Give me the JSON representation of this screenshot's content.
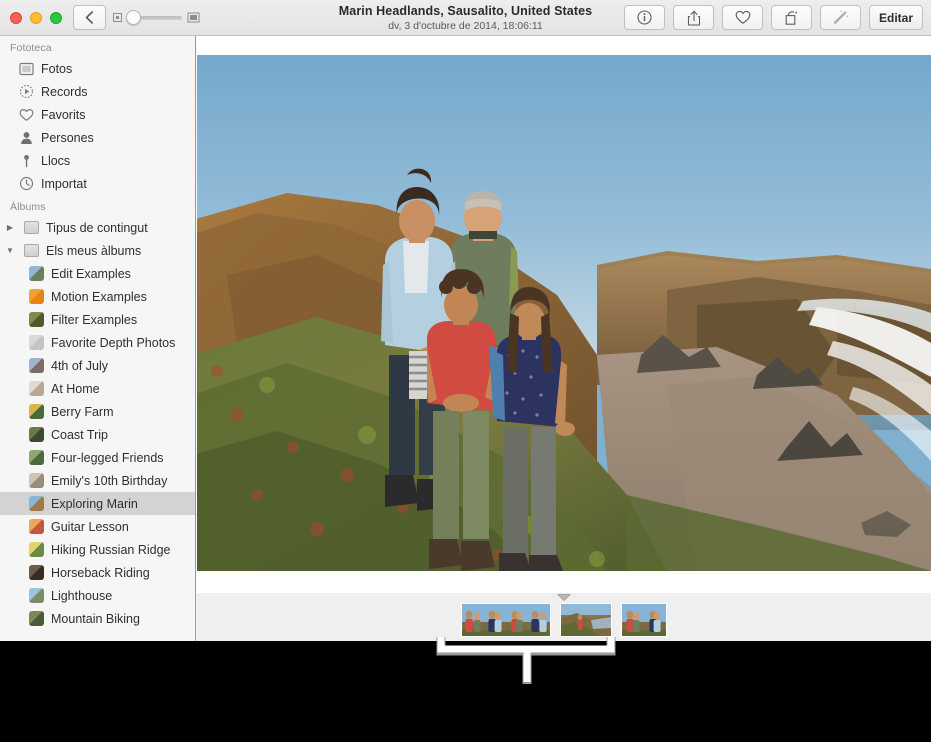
{
  "window": {
    "title": "Marin Headlands, Sausalito, United States",
    "subtitle": "dv, 3 d'octubre de 2014, 18:06:11"
  },
  "titlebar": {
    "traffic_lights": [
      {
        "name": "close",
        "color": "#ff5f57"
      },
      {
        "name": "minimize",
        "color": "#ffbd2e"
      },
      {
        "name": "zoom",
        "color": "#28c941"
      }
    ],
    "back_button": "back-icon",
    "zoom_slider": {
      "small_icon": "small-thumbnail-icon",
      "large_icon": "large-thumbnail-icon",
      "value": 12
    },
    "right_buttons": [
      {
        "name": "info-button",
        "icon": "info-icon",
        "label": ""
      },
      {
        "name": "share-button",
        "icon": "share-icon",
        "label": ""
      },
      {
        "name": "favorite-button",
        "icon": "heart-icon",
        "label": ""
      },
      {
        "name": "rotate-button",
        "icon": "rotate-icon",
        "label": ""
      },
      {
        "name": "enhance-button",
        "icon": "magic-wand-icon",
        "label": ""
      },
      {
        "name": "edit-button",
        "icon": "",
        "label": "Editar"
      }
    ]
  },
  "sidebar": {
    "library_header": "Fototeca",
    "library_items": [
      {
        "label": "Fotos",
        "icon": "photos-icon"
      },
      {
        "label": "Records",
        "icon": "memories-icon"
      },
      {
        "label": "Favorits",
        "icon": "heart-icon"
      },
      {
        "label": "Persones",
        "icon": "person-icon"
      },
      {
        "label": "Llocs",
        "icon": "pin-icon"
      },
      {
        "label": "Importat",
        "icon": "clock-icon"
      }
    ],
    "albums_header": "Àlbums",
    "groups": [
      {
        "label": "Tipus de contingut",
        "expanded": false,
        "disclosure": "chevron-right-icon"
      },
      {
        "label": "Els meus àlbums",
        "expanded": true,
        "disclosure": "chevron-down-icon"
      }
    ],
    "albums": [
      {
        "label": "Edit Examples",
        "selected": false,
        "c1": "#8fb6d4",
        "c2": "#6a7f5c"
      },
      {
        "label": "Motion Examples",
        "selected": false,
        "c1": "#f2a32c",
        "c2": "#e8831a"
      },
      {
        "label": "Filter Examples",
        "selected": false,
        "c1": "#7d8c4e",
        "c2": "#4c5a2c"
      },
      {
        "label": "Favorite Depth Photos",
        "selected": false,
        "c1": "#d9d9d9",
        "c2": "#c4c4c4"
      },
      {
        "label": "4th of July",
        "selected": false,
        "c1": "#9fb4cd",
        "c2": "#7c6a68"
      },
      {
        "label": "At Home",
        "selected": false,
        "c1": "#e0dad2",
        "c2": "#b8a898"
      },
      {
        "label": "Berry Farm",
        "selected": false,
        "c1": "#d8b84a",
        "c2": "#4a6a3a"
      },
      {
        "label": "Coast Trip",
        "selected": false,
        "c1": "#6b7a4a",
        "c2": "#3c4a2c"
      },
      {
        "label": "Four-legged Friends",
        "selected": false,
        "c1": "#8fa86b",
        "c2": "#4f6a3a"
      },
      {
        "label": "Emily's 10th Birthday",
        "selected": false,
        "c1": "#cfc3b5",
        "c2": "#9b8d7d"
      },
      {
        "label": "Exploring Marin",
        "selected": true,
        "c1": "#8ab5d6",
        "c2": "#9c7a4c"
      },
      {
        "label": "Guitar Lesson",
        "selected": false,
        "c1": "#e8a75a",
        "c2": "#c8553a"
      },
      {
        "label": "Hiking Russian Ridge",
        "selected": false,
        "c1": "#e2d46a",
        "c2": "#6b8a4a"
      },
      {
        "label": "Horseback Riding",
        "selected": false,
        "c1": "#6b5c4a",
        "c2": "#352c24"
      },
      {
        "label": "Lighthouse",
        "selected": false,
        "c1": "#9cc3de",
        "c2": "#7a8a6a"
      },
      {
        "label": "Mountain Biking",
        "selected": false,
        "c1": "#7c8a5a",
        "c2": "#4a5a3a"
      }
    ]
  },
  "main": {
    "photo_alt": "Family of four standing on coastal bluff at Marin Headlands with beach and ocean",
    "strip_marker": "current-photo-marker",
    "thumbnail_groups": [
      {
        "count": 4,
        "orientation": "portrait"
      },
      {
        "count": 1,
        "orientation": "landscape"
      },
      {
        "count": 2,
        "orientation": "portrait"
      }
    ]
  },
  "callout": {
    "name": "thumbnail-strip-callout-bracket",
    "color": "#ffffff"
  }
}
